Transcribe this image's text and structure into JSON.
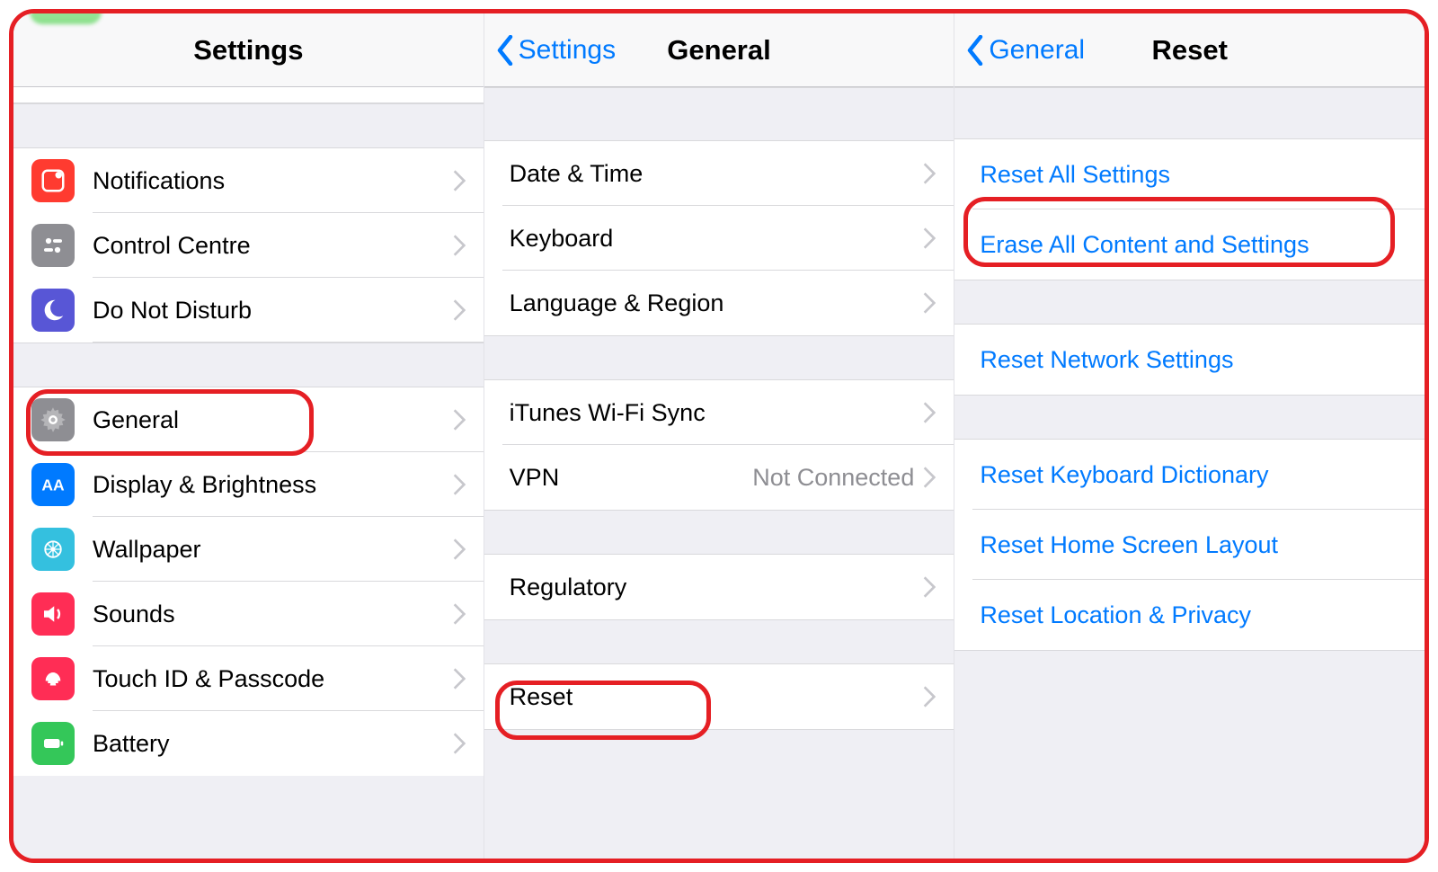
{
  "panels": {
    "settings": {
      "title": "Settings",
      "rows": {
        "notifications": "Notifications",
        "control_centre": "Control Centre",
        "dnd": "Do Not Disturb",
        "general": "General",
        "display": "Display & Brightness",
        "wallpaper": "Wallpaper",
        "sounds": "Sounds",
        "touchid": "Touch ID & Passcode",
        "battery": "Battery"
      }
    },
    "general": {
      "back": "Settings",
      "title": "General",
      "rows": {
        "datetime": "Date & Time",
        "keyboard": "Keyboard",
        "language": "Language & Region",
        "itunes": "iTunes Wi-Fi Sync",
        "vpn": "VPN",
        "vpn_detail": "Not Connected",
        "regulatory": "Regulatory",
        "reset": "Reset"
      }
    },
    "reset": {
      "back": "General",
      "title": "Reset",
      "rows": {
        "all": "Reset All Settings",
        "erase": "Erase All Content and Settings",
        "network": "Reset Network Settings",
        "keyboard": "Reset Keyboard Dictionary",
        "home": "Reset Home Screen Layout",
        "location": "Reset Location & Privacy"
      }
    }
  }
}
